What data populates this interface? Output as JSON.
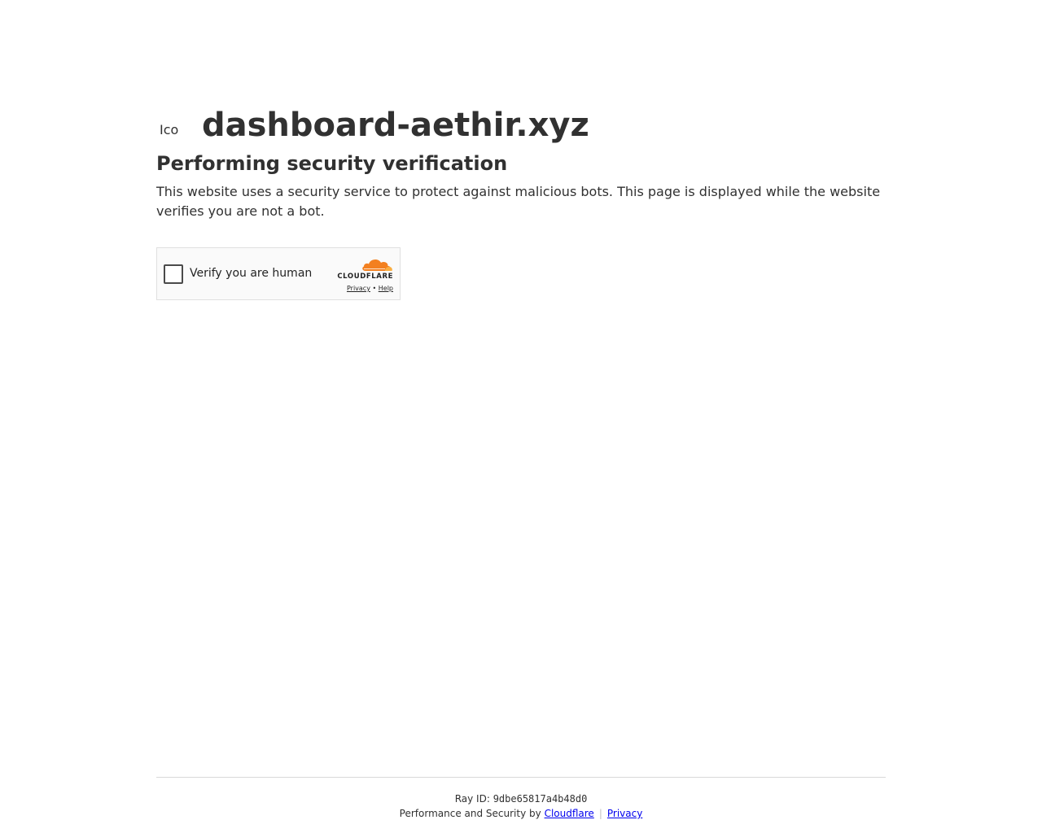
{
  "site": {
    "favicon_alt": "Icon for dashboard-aethir.xyz",
    "name": "dashboard-aethir.xyz"
  },
  "content": {
    "heading": "Performing security verification",
    "description": "This website uses a security service to protect against malicious bots. This page is displayed while the website verifies you are not a bot."
  },
  "widget": {
    "checkbox_label": "Verify you are human",
    "brand_word": "CLOUDFLARE",
    "privacy_link": "Privacy",
    "bullet": "•",
    "help_link": "Help",
    "checked": false
  },
  "footer": {
    "ray_label": "Ray ID:",
    "ray_id": "9dbe65817a4b48d0",
    "perf_text": "Performance and Security by",
    "cloudflare_link": "Cloudflare",
    "separator": "|",
    "privacy_link": "Privacy"
  },
  "colors": {
    "text": "#313131",
    "link": "#0000ee",
    "cloudflare_orange": "#f38020",
    "cloudflare_light_orange": "#faae40"
  }
}
